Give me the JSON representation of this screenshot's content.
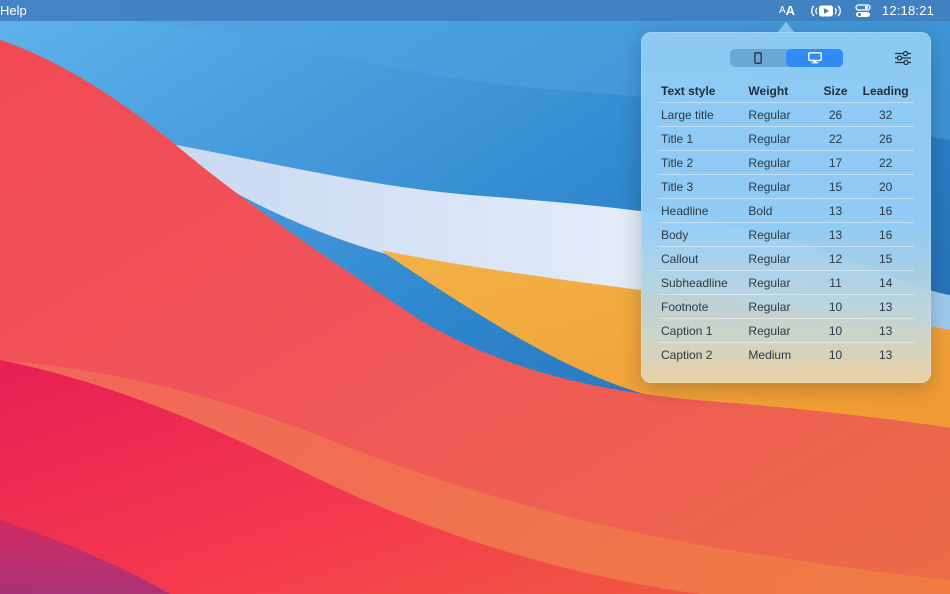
{
  "menubar": {
    "menu_help": "Help",
    "text_size_small": "A",
    "text_size_large": "A",
    "cast_icon": "airplay-video-icon",
    "control_center_icon": "control-center-icon",
    "clock": "12:18:21"
  },
  "popover": {
    "device_segment": {
      "options": [
        "phone-icon",
        "desktop-icon"
      ],
      "selected": "desktop-icon"
    },
    "settings_icon": "sliders-icon",
    "table": {
      "headers": {
        "style": "Text style",
        "weight": "Weight",
        "size": "Size",
        "leading": "Leading"
      },
      "rows": [
        {
          "style": "Large title",
          "weight": "Regular",
          "size": "26",
          "leading": "32"
        },
        {
          "style": "Title 1",
          "weight": "Regular",
          "size": "22",
          "leading": "26"
        },
        {
          "style": "Title 2",
          "weight": "Regular",
          "size": "17",
          "leading": "22"
        },
        {
          "style": "Title 3",
          "weight": "Regular",
          "size": "15",
          "leading": "20"
        },
        {
          "style": "Headline",
          "weight": "Bold",
          "size": "13",
          "leading": "16"
        },
        {
          "style": "Body",
          "weight": "Regular",
          "size": "13",
          "leading": "16"
        },
        {
          "style": "Callout",
          "weight": "Regular",
          "size": "12",
          "leading": "15"
        },
        {
          "style": "Subheadline",
          "weight": "Regular",
          "size": "11",
          "leading": "14"
        },
        {
          "style": "Footnote",
          "weight": "Regular",
          "size": "10",
          "leading": "13"
        },
        {
          "style": "Caption 1",
          "weight": "Regular",
          "size": "10",
          "leading": "13"
        },
        {
          "style": "Caption 2",
          "weight": "Medium",
          "size": "10",
          "leading": "13"
        }
      ]
    }
  },
  "colors": {
    "accent": "#2f8cf5",
    "menubar": "#407ebe"
  }
}
